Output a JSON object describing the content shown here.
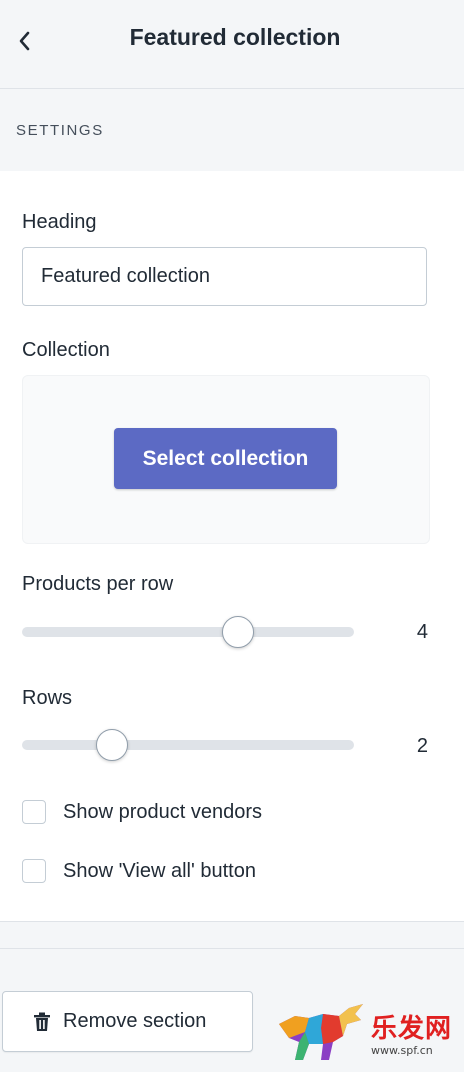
{
  "header": {
    "title": "Featured collection",
    "back_icon": "chevron-left-icon"
  },
  "section": {
    "label": "SETTINGS"
  },
  "heading_field": {
    "label": "Heading",
    "value": "Featured collection"
  },
  "collection": {
    "label": "Collection",
    "button_label": "Select collection",
    "button_color": "#5c6ac4"
  },
  "products_per_row": {
    "label": "Products per row",
    "value": "4",
    "slider_fraction": 0.65
  },
  "rows": {
    "label": "Rows",
    "value": "2",
    "slider_fraction": 0.27
  },
  "checkboxes": [
    {
      "label": "Show product vendors",
      "checked": false
    },
    {
      "label": "Show 'View all' button",
      "checked": false
    }
  ],
  "footer": {
    "remove_label": "Remove section",
    "remove_icon": "trash-icon"
  },
  "watermark": {
    "text": "乐发网",
    "url": "www.spf.cn"
  }
}
